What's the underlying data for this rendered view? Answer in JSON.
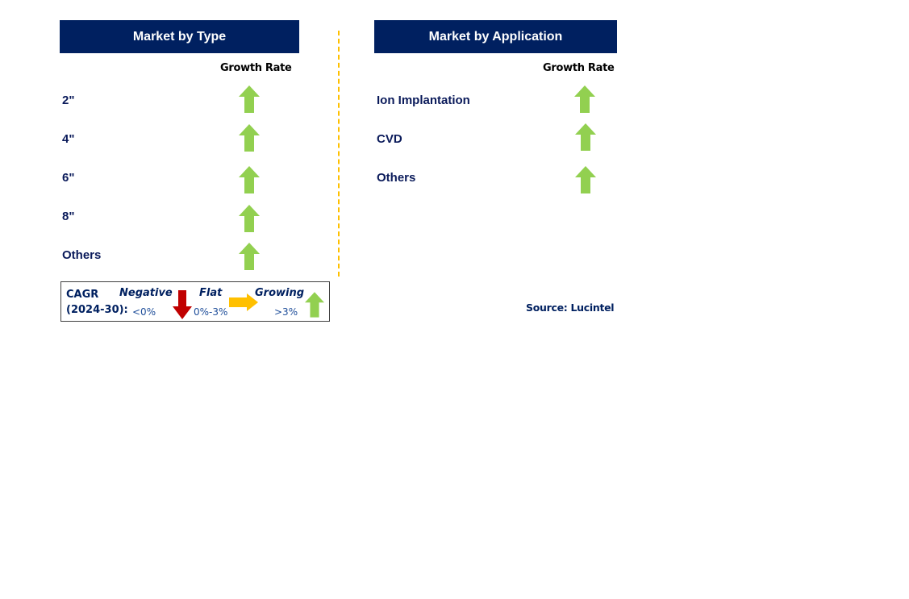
{
  "left_panel": {
    "title": "Market by Type",
    "column_header": "Growth Rate",
    "rows": [
      {
        "label": "2\"",
        "trend": "growing"
      },
      {
        "label": "4\"",
        "trend": "growing"
      },
      {
        "label": "6\"",
        "trend": "growing"
      },
      {
        "label": "8\"",
        "trend": "growing"
      },
      {
        "label": "Others",
        "trend": "growing"
      }
    ]
  },
  "right_panel": {
    "title": "Market by Application",
    "column_header": "Growth Rate",
    "rows": [
      {
        "label": "Ion Implantation",
        "trend": "growing"
      },
      {
        "label": "CVD",
        "trend": "growing"
      },
      {
        "label": "Others",
        "trend": "growing"
      }
    ]
  },
  "legend": {
    "cagr_label": "CAGR",
    "period_label": "(2024-30):",
    "negative": {
      "label": "Negative",
      "range": "<0%",
      "icon": "arrow-down-icon"
    },
    "flat": {
      "label": "Flat",
      "range": "0%-3%",
      "icon": "arrow-right-icon"
    },
    "growing": {
      "label": "Growing",
      "range": ">3%",
      "icon": "arrow-up-icon"
    }
  },
  "source": "Source: Lucintel",
  "colors": {
    "header_bg": "#002060",
    "growing": "#92d050",
    "flat": "#ffc000",
    "negative": "#c00000",
    "divider": "#ffc000"
  }
}
